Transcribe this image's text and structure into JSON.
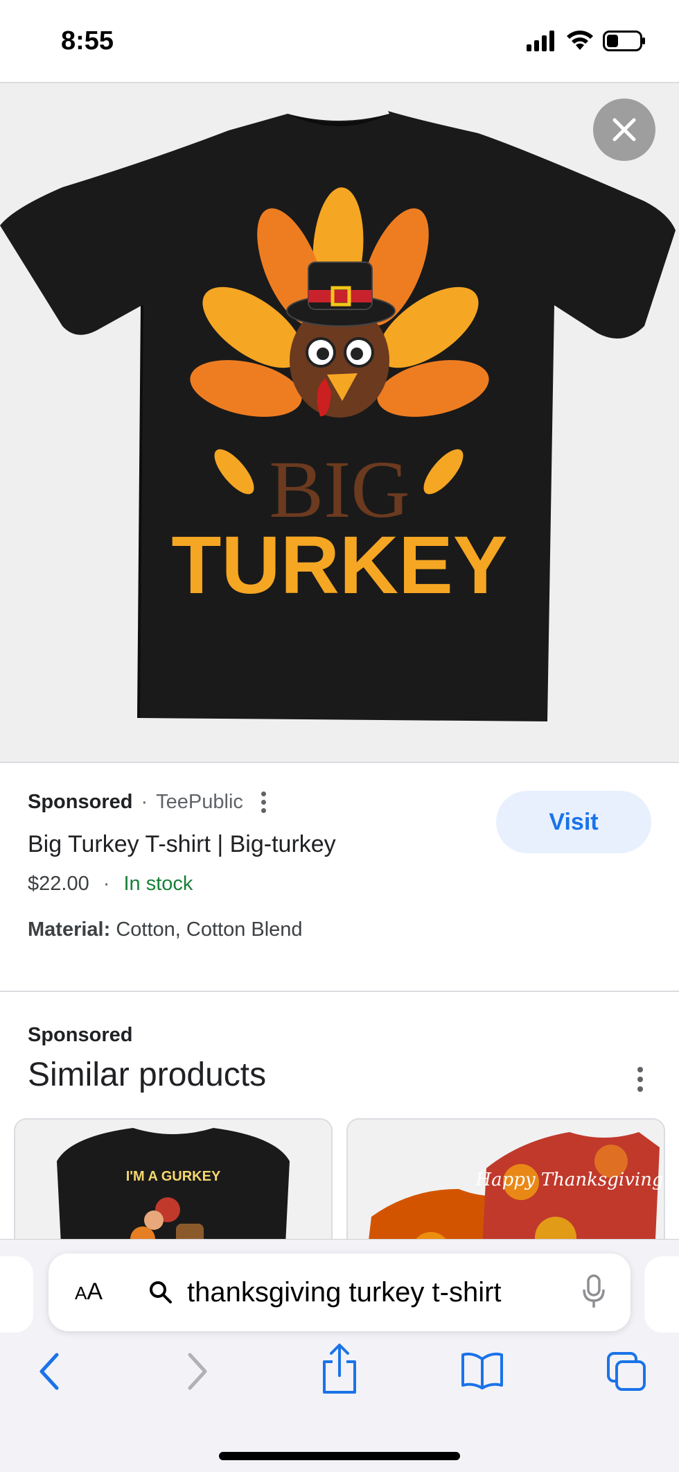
{
  "status_bar": {
    "time": "8:55"
  },
  "hero": {
    "shirt_top_text": "BIG",
    "shirt_bottom_text": "TURKEY"
  },
  "product": {
    "sponsored_label": "Sponsored",
    "separator": "·",
    "merchant": "TeePublic",
    "title": "Big Turkey T-shirt | Big-turkey",
    "price": "$22.00",
    "stock": "In stock",
    "material_label": "Material:",
    "material_value": " Cotton, Cotton Blend",
    "visit_label": "Visit"
  },
  "similar": {
    "sponsored_label": "Sponsored",
    "heading": "Similar products",
    "cards": [
      {
        "shirt_text": "I'M A GURKEY"
      },
      {
        "shirt_text": "Happy Thanksgiving"
      }
    ]
  },
  "browser": {
    "aa_small": "A",
    "aa_large": "A",
    "url_text": "thanksgiving turkey t-shirt"
  },
  "colors": {
    "accent_blue": "#1a73e8",
    "stock_green": "#188038",
    "visit_bg": "#e8f0fe"
  }
}
